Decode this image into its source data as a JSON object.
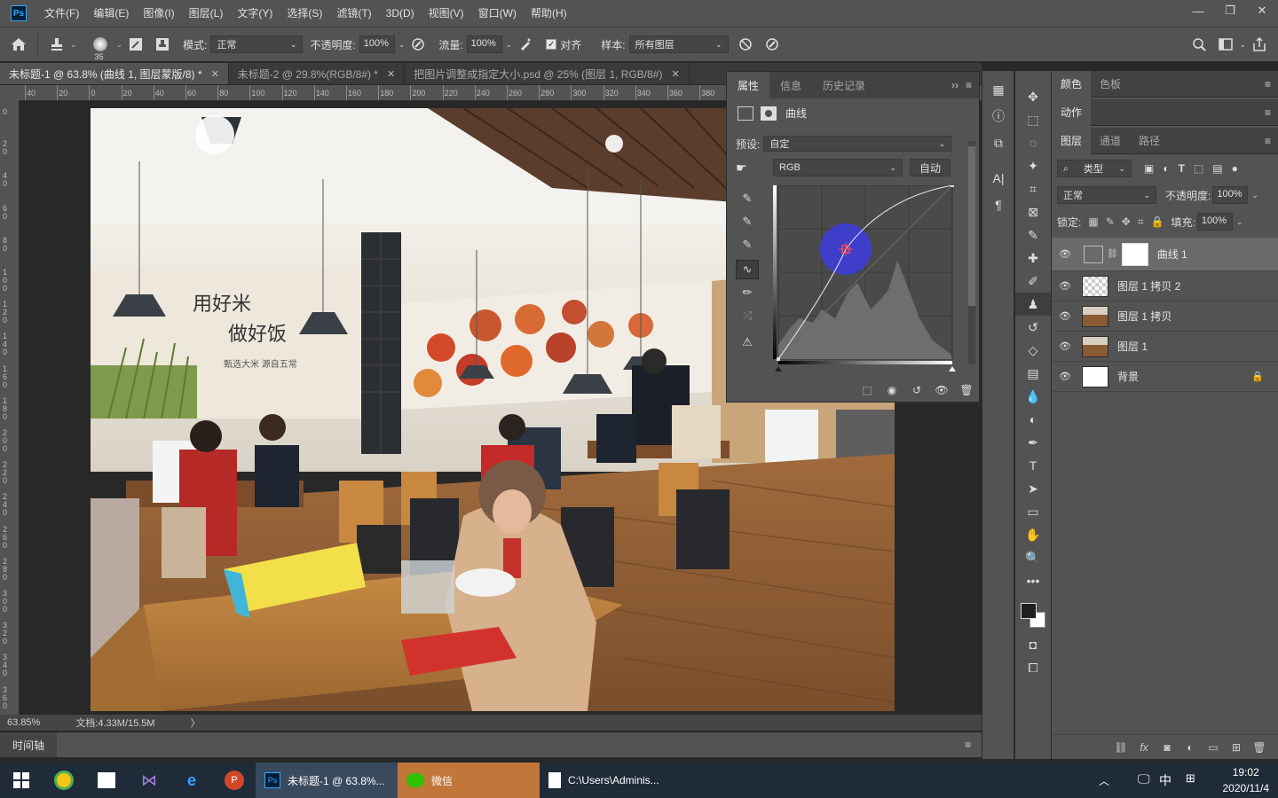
{
  "app": {
    "logo": "Ps",
    "menu": [
      "文件(F)",
      "编辑(E)",
      "图像(I)",
      "图层(L)",
      "文字(Y)",
      "选择(S)",
      "滤镜(T)",
      "3D(D)",
      "视图(V)",
      "窗口(W)",
      "帮助(H)"
    ],
    "window_controls": [
      "—",
      "❐",
      "✕"
    ]
  },
  "options": {
    "brush_size": "35",
    "mode_label": "模式:",
    "mode_value": "正常",
    "opacity_label": "不透明度:",
    "opacity_value": "100%",
    "flow_label": "流量:",
    "flow_value": "100%",
    "align_label": "对齐",
    "sample_label": "样本:",
    "sample_value": "所有图层"
  },
  "doc_tabs": [
    {
      "label": "未标题-1 @ 63.8% (曲线 1, 图层蒙版/8) *",
      "active": true
    },
    {
      "label": "未标题-2 @ 29.8%(RGB/8#) *",
      "active": false
    },
    {
      "label": "把图片调整成指定大小.psd @ 25% (图层 1, RGB/8#)",
      "active": false
    }
  ],
  "ruler_top": [
    "40",
    "20",
    "0",
    "20",
    "40",
    "60",
    "80",
    "100",
    "120",
    "140",
    "160",
    "180",
    "200",
    "220",
    "240",
    "260",
    "280",
    "300",
    "320",
    "340",
    "360",
    "380"
  ],
  "ruler_left": [
    "0",
    "20",
    "40",
    "60",
    "80",
    "100",
    "120",
    "140",
    "160",
    "180",
    "200",
    "220",
    "240",
    "260",
    "280",
    "300",
    "320",
    "340",
    "360"
  ],
  "status": {
    "zoom": "63.85%",
    "doc_info": "文档:4.33M/15.5M",
    "arrow": "〉",
    "timeline_tab": "时间轴"
  },
  "properties": {
    "tabs": [
      "属性",
      "信息",
      "历史记录"
    ],
    "title": "曲线",
    "preset_label": "预设:",
    "preset_value": "自定",
    "channel_value": "RGB",
    "auto_button": "自动"
  },
  "photo_text": {
    "slogan1": "用好米",
    "slogan2": "做好饭",
    "slogan3": "甄选大米  源自五常"
  },
  "panels": {
    "top_tabs": [
      "颜色",
      "色板"
    ],
    "actions_tab": "动作",
    "layer_tabs": [
      "图层",
      "通道",
      "路径"
    ],
    "filter_label": "类型",
    "blend_mode": "正常",
    "opacity_label": "不透明度:",
    "opacity_value": "100%",
    "lock_label": "锁定:",
    "fill_label": "填充:",
    "fill_value": "100%",
    "layers": [
      {
        "name": "曲线 1",
        "selected": true
      },
      {
        "name": "图层 1 拷贝 2",
        "selected": false
      },
      {
        "name": "图层 1 拷贝",
        "selected": false
      },
      {
        "name": "图层 1",
        "selected": false
      },
      {
        "name": "背景",
        "selected": false
      }
    ]
  },
  "taskbar": {
    "ps_app": "未标题-1 @ 63.8%...",
    "wechat_app": "微信",
    "explorer_app": "C:\\Users\\Adminis...",
    "ime1": "中",
    "time": "19:02",
    "date": "2020/11/4"
  },
  "colors": {
    "accent": "#31a8ff",
    "wechat_tab": "#c1763a",
    "curve_point_halo": "#3c3ce0"
  }
}
